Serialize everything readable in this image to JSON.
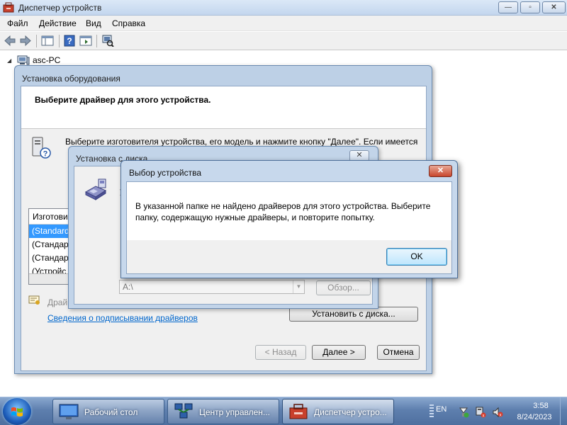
{
  "window": {
    "title": "Диспетчер устройств",
    "controls": {
      "minimize": "—",
      "maximize": "▫",
      "close": "✕"
    }
  },
  "menu": [
    "Файл",
    "Действие",
    "Вид",
    "Справка"
  ],
  "tree": {
    "root": "asc-PC"
  },
  "hardware_wizard": {
    "title": "Установка оборудования",
    "heading": "Выберите драйвер для этого устройства.",
    "description": "Выберите изготовителя устройства, его модель и нажмите кнопку \"Далее\". Если имеется",
    "list_header": "Изготови",
    "list_items": [
      "(Standard",
      "(Стандарт",
      "(Стандарт",
      "(Устройс"
    ],
    "signed_label": "Драй",
    "signing_link": "Сведения о подписывании драйверов",
    "install_from_disk": "Установить с диска...",
    "back": "< Назад",
    "next": "Далее >",
    "cancel": "Отмена"
  },
  "install_from_disk": {
    "title": "Установка с диска",
    "close": "✕",
    "text_fragment_1": "В",
    "text_fragment_2": "У",
    "copy_label_fragment": "К",
    "path": "A:\\",
    "browse": "Обзор..."
  },
  "select_device": {
    "title": "Выбор устройства",
    "close": "✕",
    "message": "В указанной папке не найдено драйверов для этого устройства. Выберите папку, содержащую нужные драйверы, и повторите попытку.",
    "ok": "OK"
  },
  "taskbar": {
    "tasks": [
      {
        "label": "Рабочий стол",
        "icon": "desktop-icon"
      },
      {
        "label": "Центр управлен...",
        "icon": "network-center-icon"
      },
      {
        "label": "Диспетчер устро...",
        "icon": "device-manager-icon"
      }
    ],
    "tray": {
      "language": "EN",
      "time": "3:58",
      "date": "8/24/2023"
    }
  }
}
